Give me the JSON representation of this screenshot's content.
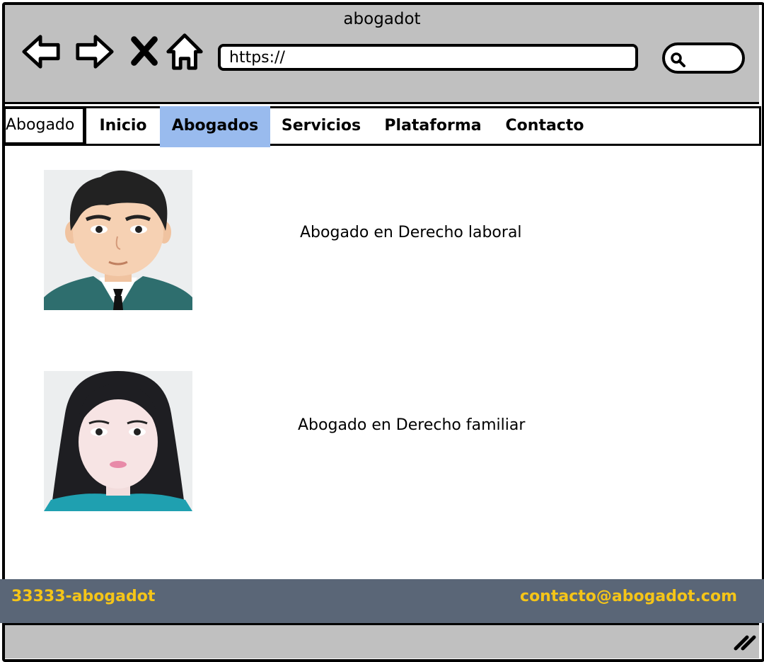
{
  "window": {
    "title": "abogadot"
  },
  "toolbar": {
    "icons": [
      "back-arrow-icon",
      "forward-arrow-icon",
      "close-icon",
      "home-icon",
      "search-icon"
    ],
    "url": "https://"
  },
  "nav": {
    "brand": "Abogado",
    "items": [
      {
        "label": "Inicio",
        "active": false
      },
      {
        "label": "Abogados",
        "active": true
      },
      {
        "label": "Servicios",
        "active": false
      },
      {
        "label": "Plataforma",
        "active": false
      },
      {
        "label": "Contacto",
        "active": false
      }
    ],
    "active_color": "#99bbee"
  },
  "lawyers": [
    {
      "title": "Abogado en Derecho laboral",
      "avatar": "male-avatar"
    },
    {
      "title": "Abogado en Derecho familiar",
      "avatar": "female-avatar"
    }
  ],
  "footer": {
    "phone": "33333-abogadot",
    "email": "contacto@abogadot.com",
    "text_color": "#f5c518",
    "background": "#5a6677"
  }
}
